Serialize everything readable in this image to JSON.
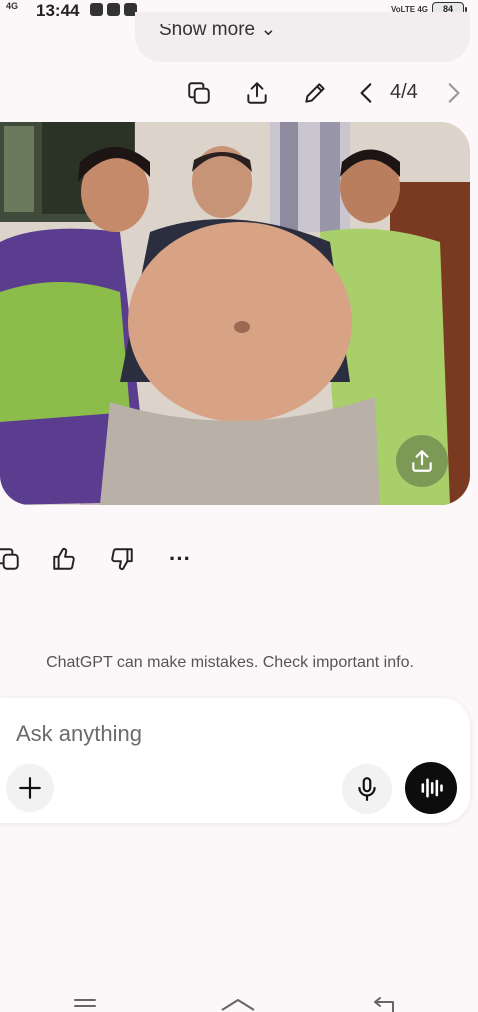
{
  "status_bar": {
    "network": "4G",
    "time": "13:44",
    "app_icons": [
      "message-icon",
      "youtube-icon",
      "shield-icon"
    ],
    "signal_text": "VoLTE 4G",
    "battery": "84"
  },
  "conversation": {
    "show_more_label": "Show more",
    "page_counter": "4/4"
  },
  "image_toolbar": {
    "icons": [
      "copy-icon",
      "share-icon",
      "edit-icon",
      "chevron-left-icon",
      "chevron-right-icon"
    ]
  },
  "response_actions": {
    "icons": [
      "copy-icon",
      "thumbs-up-icon",
      "thumbs-down-icon",
      "more-icon"
    ],
    "more_glyph": "···"
  },
  "disclaimer": "ChatGPT can make mistakes. Check important info.",
  "composer": {
    "placeholder": "Ask anything",
    "value": ""
  },
  "nav_bar": {
    "icons": [
      "menu-icon",
      "home-icon",
      "back-icon"
    ]
  },
  "colors": {
    "background": "#fcf8fa",
    "voice_button": "#0d0d0d",
    "composer_bg": "#ffffff"
  }
}
